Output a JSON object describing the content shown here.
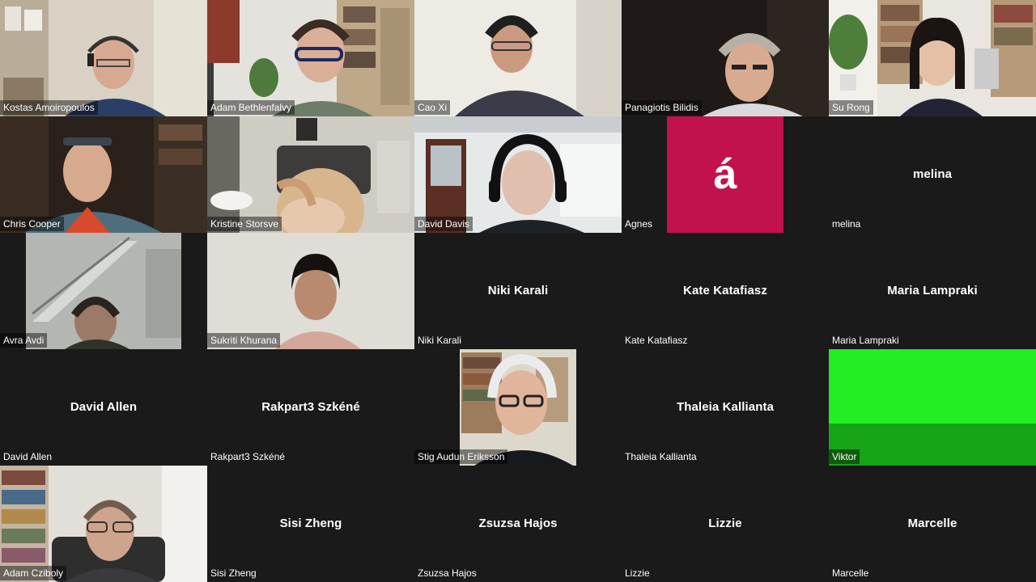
{
  "colors": {
    "background": "#1a1a1a",
    "label_text": "#ffffff",
    "avatar_agnes": "#c2124d",
    "viktor_green_light": "#22ee22",
    "viktor_green_dark": "#16a516"
  },
  "participants": [
    {
      "name": "Kostas Amoiropoulos",
      "video": true
    },
    {
      "name": "Adam Bethlenfalvy",
      "video": true
    },
    {
      "name": "Cao Xi",
      "video": true
    },
    {
      "name": "Panagiotis Bilidis",
      "video": true
    },
    {
      "name": "Su Rong",
      "video": true
    },
    {
      "name": "Chris Cooper",
      "video": true
    },
    {
      "name": "Kristine Storsve",
      "video": true
    },
    {
      "name": "David Davis",
      "video": true
    },
    {
      "name": "Agnes",
      "video": false,
      "avatar_letter": "á"
    },
    {
      "name": "melina",
      "video": false,
      "display_name": "melina"
    },
    {
      "name": "Avra Avdi",
      "video": true
    },
    {
      "name": "Sukriti Khurana",
      "video": true
    },
    {
      "name": "Niki Karali",
      "video": false,
      "display_name": "Niki Karali"
    },
    {
      "name": "Kate Katafiasz",
      "video": false,
      "display_name": "Kate Katafiasz"
    },
    {
      "name": "Maria Lampraki",
      "video": false,
      "display_name": "Maria Lampraki"
    },
    {
      "name": "David Allen",
      "video": false,
      "display_name": "David Allen"
    },
    {
      "name": "Rakpart3 Szkéné",
      "video": false,
      "display_name": "Rakpart3 Szkéné"
    },
    {
      "name": "Stig Audun Eriksson",
      "video": true
    },
    {
      "name": "Thaleia Kallianta",
      "video": false,
      "display_name": "Thaleia Kallianta"
    },
    {
      "name": "Viktor",
      "video": true
    },
    {
      "name": "Adam Cziboly",
      "video": true
    },
    {
      "name": "Sisi Zheng",
      "video": false,
      "display_name": "Sisi Zheng"
    },
    {
      "name": "Zsuzsa Hajos",
      "video": false,
      "display_name": "Zsuzsa Hajos"
    },
    {
      "name": "Lizzie",
      "video": false,
      "display_name": "Lizzie"
    },
    {
      "name": "Marcelle",
      "video": false,
      "display_name": "Marcelle"
    }
  ]
}
